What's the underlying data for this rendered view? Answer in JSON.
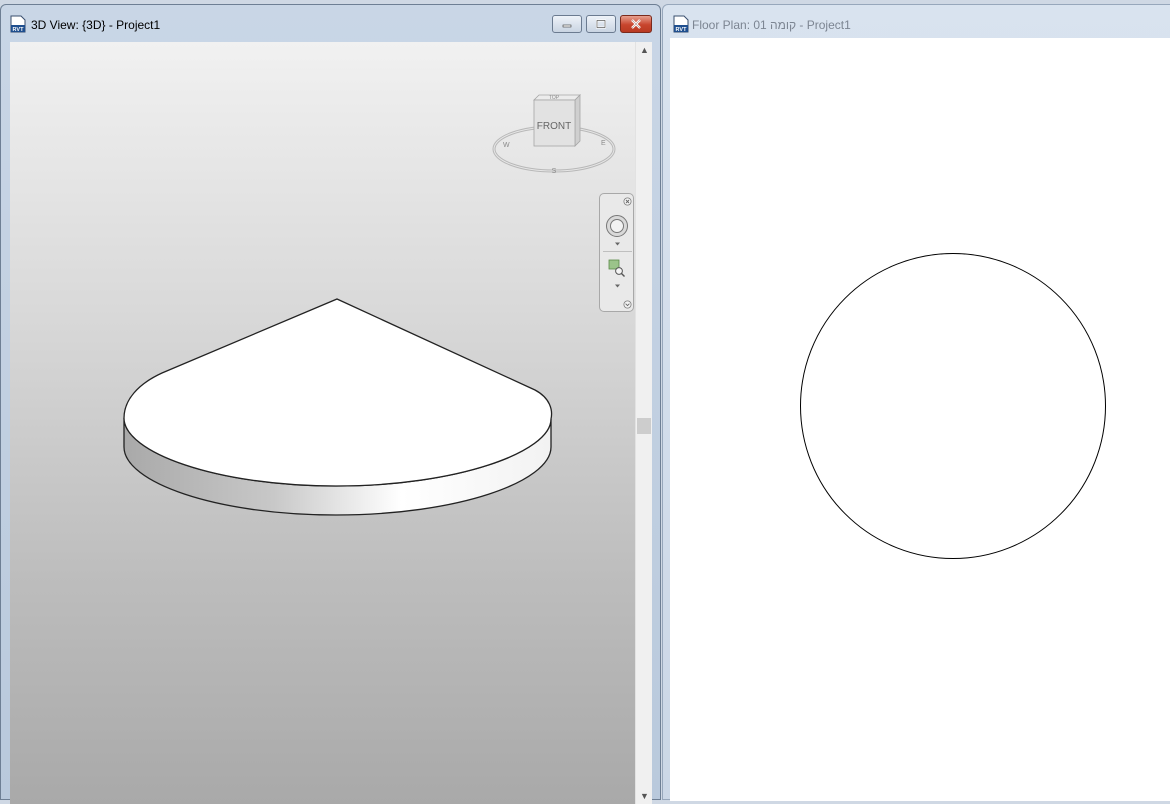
{
  "windows": {
    "view3d": {
      "title": "3D View: {3D} - Project1",
      "icon": "revit-file-icon",
      "viewcube": {
        "face_label": "FRONT",
        "top_label": "TOP"
      },
      "controls": [
        "minimize-icon",
        "maximize-icon",
        "close-icon"
      ],
      "navigation_bar": [
        "close-icon",
        "steering-wheel-icon",
        "zoom-region-icon",
        "options-icon"
      ]
    },
    "floorplan": {
      "title": "Floor Plan: 01 קומה - Project1",
      "icon": "revit-file-icon"
    }
  },
  "colors": {
    "close_button": "#c8452d",
    "title_bar": "#c9d6e6",
    "canvas_plan": "#ffffff"
  }
}
